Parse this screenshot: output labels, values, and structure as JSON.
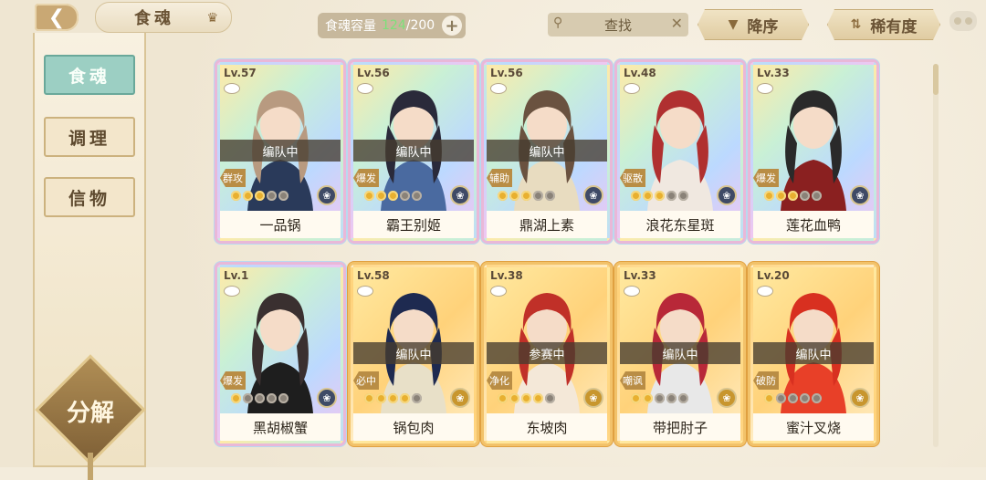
{
  "topbar": {
    "title": "食魂",
    "capacity_label": "食魂容量",
    "capacity_current": "124",
    "capacity_total": "/200",
    "search_label": "查找",
    "sort_desc_label": "降序",
    "sort_rarity_label": "稀有度"
  },
  "side": {
    "tabs": [
      {
        "label": "食魂"
      },
      {
        "label": "调理"
      },
      {
        "label": "信物"
      }
    ],
    "decompose_label": "分解"
  },
  "cards": [
    {
      "level": "Lv.57",
      "name": "一品锅",
      "status": "编队中",
      "role": "群攻",
      "stars": 3,
      "frame": "rainbow",
      "hair": "#b89a80",
      "outfit": "#2a3a5a"
    },
    {
      "level": "Lv.56",
      "name": "霸王别姬",
      "status": "编队中",
      "role": "爆发",
      "stars": 3,
      "frame": "rainbow",
      "hair": "#2a2a3a",
      "outfit": "#4a6aa0"
    },
    {
      "level": "Lv.56",
      "name": "鼎湖上素",
      "status": "编队中",
      "role": "辅助",
      "stars": 3,
      "frame": "rainbow",
      "hair": "#6a5240",
      "outfit": "#e8dcc0"
    },
    {
      "level": "Lv.48",
      "name": "浪花东星斑",
      "status": "",
      "role": "驱散",
      "stars": 3,
      "frame": "rainbow",
      "hair": "#b03030",
      "outfit": "#f0e8e0"
    },
    {
      "level": "Lv.33",
      "name": "莲花血鸭",
      "status": "",
      "role": "爆发",
      "stars": 3,
      "frame": "rainbow",
      "hair": "#2a2a2a",
      "outfit": "#8a2020"
    },
    {
      "level": "Lv.1",
      "name": "黑胡椒蟹",
      "status": "",
      "role": "爆发",
      "stars": 1,
      "frame": "rainbow",
      "hair": "#3a3030",
      "outfit": "#1e1e1e"
    },
    {
      "level": "Lv.58",
      "name": "锅包肉",
      "status": "编队中",
      "role": "必中",
      "stars": 4,
      "frame": "gold",
      "hair": "#1e2a50",
      "outfit": "#e8e0c8"
    },
    {
      "level": "Lv.38",
      "name": "东坡肉",
      "status": "参赛中",
      "role": "净化",
      "stars": 4,
      "frame": "gold",
      "hair": "#c03028",
      "outfit": "#f4e8d8"
    },
    {
      "level": "Lv.33",
      "name": "带把肘子",
      "status": "编队中",
      "role": "嘲讽",
      "stars": 2,
      "frame": "gold",
      "hair": "#b82838",
      "outfit": "#e8e8e8"
    },
    {
      "level": "Lv.20",
      "name": "蜜汁叉烧",
      "status": "编队中",
      "role": "破防",
      "stars": 1,
      "frame": "gold",
      "hair": "#d83020",
      "outfit": "#e84028"
    }
  ]
}
